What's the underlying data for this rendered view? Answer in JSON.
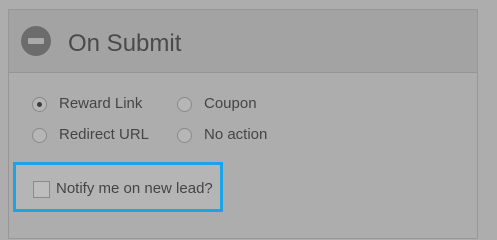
{
  "section": {
    "title": "On Submit",
    "collapse_icon": "minus-circle-icon"
  },
  "options": [
    {
      "label": "Reward Link",
      "checked": true
    },
    {
      "label": "Coupon",
      "checked": false
    },
    {
      "label": "Redirect URL",
      "checked": false
    },
    {
      "label": "No action",
      "checked": false
    }
  ],
  "notify": {
    "label": "Notify me on new lead?",
    "checked": false,
    "highlight_color": "#1aa3e6"
  }
}
